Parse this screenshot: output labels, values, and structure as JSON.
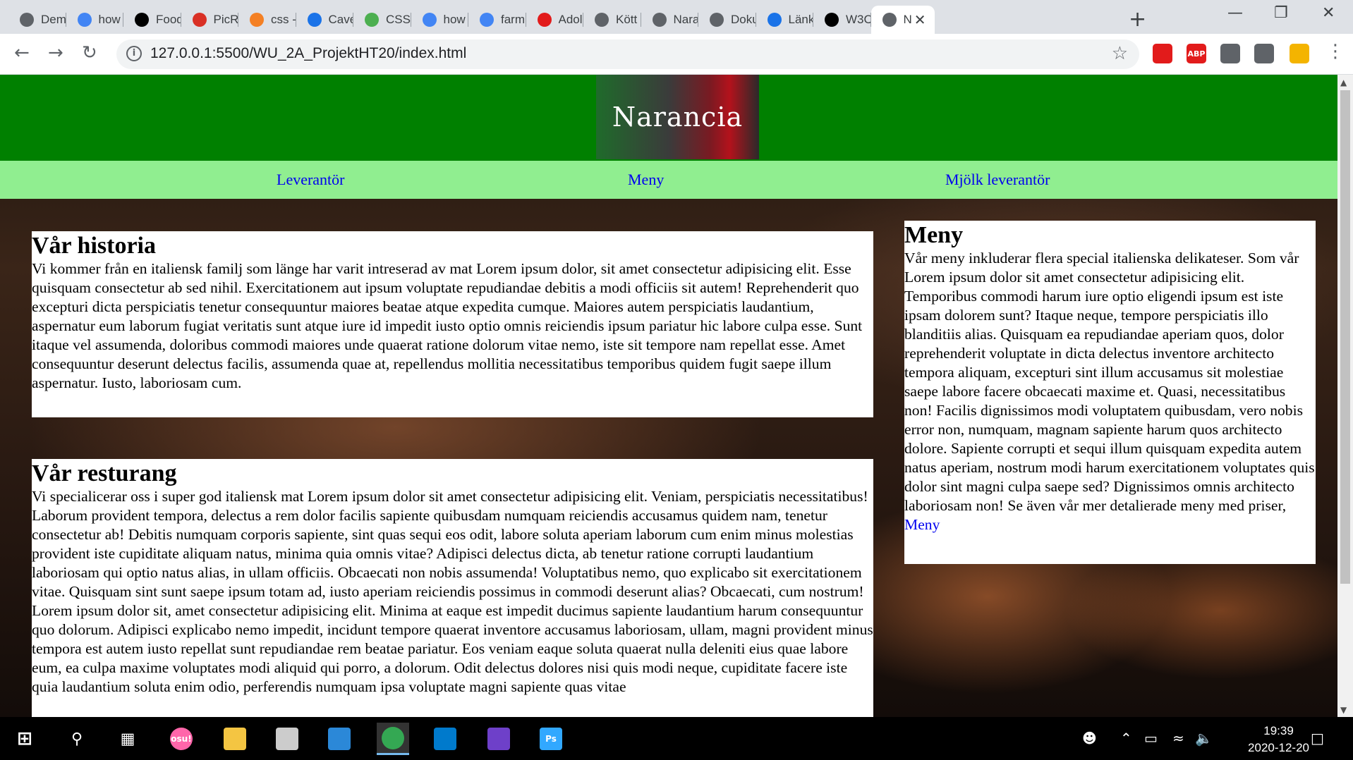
{
  "browser": {
    "tabs": [
      {
        "label": "Dem",
        "icon": "globe-icon",
        "color": "#5f6368"
      },
      {
        "label": "how",
        "icon": "google-icon",
        "color": "#4285f4"
      },
      {
        "label": "Food",
        "icon": "unsplash-icon",
        "color": "#000000"
      },
      {
        "label": "PicRe",
        "icon": "picresize-icon",
        "color": "#d93025"
      },
      {
        "label": "css -",
        "icon": "stackoverflow-icon",
        "color": "#f48024"
      },
      {
        "label": "Cave",
        "icon": "f-icon",
        "color": "#1a73e8"
      },
      {
        "label": "CSS",
        "icon": "w3schools-icon",
        "color": "#4caf50"
      },
      {
        "label": "how",
        "icon": "google-icon",
        "color": "#4285f4"
      },
      {
        "label": "farm",
        "icon": "google-icon",
        "color": "#4285f4"
      },
      {
        "label": "Adol",
        "icon": "adobe-icon",
        "color": "#e21b1b"
      },
      {
        "label": "Kött",
        "icon": "globe-icon",
        "color": "#5f6368"
      },
      {
        "label": "Nara",
        "icon": "globe-icon",
        "color": "#5f6368"
      },
      {
        "label": "Doku",
        "icon": "globe-icon",
        "color": "#5f6368"
      },
      {
        "label": "Länk",
        "icon": "contact-icon",
        "color": "#1a73e8"
      },
      {
        "label": "W3C",
        "icon": "w3c-icon",
        "color": "#000000"
      },
      {
        "label": "N",
        "icon": "globe-icon",
        "color": "#5f6368"
      }
    ],
    "url": "127.0.0.1:5500/WU_2A_ProjektHT20/index.html",
    "extensions": [
      {
        "name": "pdf-extension-icon",
        "label": "",
        "color": "#e21b1b"
      },
      {
        "name": "adblock-icon",
        "label": "ABP",
        "color": "#e21b1b"
      },
      {
        "name": "extension-icon",
        "label": "",
        "color": "#5f6368"
      },
      {
        "name": "puzzle-icon",
        "label": "",
        "color": "#5f6368"
      },
      {
        "name": "profile-icon",
        "label": "",
        "color": "#f4b400"
      }
    ]
  },
  "site": {
    "logo": "Narancia",
    "nav": [
      "Leverantör",
      "Meny",
      "Mjölk leverantör"
    ],
    "story": {
      "title": "Vår historia",
      "text": "Vi kommer från en italiensk familj som länge har varit intreserad av mat Lorem ipsum dolor, sit amet consectetur adipisicing elit. Esse quisquam consectetur ab sed nihil. Exercitationem aut ipsum voluptate repudiandae debitis a modi officiis sit autem! Reprehenderit quo excepturi dicta perspiciatis tenetur consequuntur maiores beatae atque expedita cumque. Maiores autem perspiciatis laudantium, aspernatur eum laborum fugiat veritatis sunt atque iure id impedit iusto optio omnis reiciendis ipsum pariatur hic labore culpa esse. Sunt itaque vel assumenda, doloribus commodi maiores unde quaerat ratione dolorum vitae nemo, iste sit tempore nam repellat esse. Amet consequuntur deserunt delectus facilis, assumenda quae at, repellendus mollitia necessitatibus temporibus quidem fugit saepe illum aspernatur. Iusto, laboriosam cum."
    },
    "restaurant": {
      "title": "Vår resturang",
      "text": "Vi specialicerar oss i super god italiensk mat Lorem ipsum dolor sit amet consectetur adipisicing elit. Veniam, perspiciatis necessitatibus! Laborum provident tempora, delectus a rem dolor facilis sapiente quibusdam numquam reiciendis accusamus quidem nam, tenetur consectetur ab! Debitis numquam corporis sapiente, sint quas sequi eos odit, labore soluta aperiam laborum cum enim minus molestias provident iste cupiditate aliquam natus, minima quia omnis vitae? Adipisci delectus dicta, ab tenetur ratione corrupti laudantium laboriosam qui optio natus alias, in ullam officiis. Obcaecati non nobis assumenda! Voluptatibus nemo, quo explicabo sit exercitationem vitae. Quisquam sint sunt saepe ipsum totam ad, iusto aperiam reiciendis possimus in commodi deserunt alias? Obcaecati, cum nostrum! Lorem ipsum dolor sit, amet consectetur adipisicing elit. Minima at eaque est impedit ducimus sapiente laudantium harum consequuntur quo dolorum. Adipisci explicabo nemo impedit, incidunt tempore quaerat inventore accusamus laboriosam, ullam, magni provident minus tempora est autem iusto repellat sunt repudiandae rem beatae pariatur. Eos veniam eaque soluta quaerat nulla deleniti eius quae labore eum, ea culpa maxime voluptates modi aliquid qui porro, a dolorum. Odit delectus dolores nisi quis modi neque, cupiditate facere iste quia laudantium soluta enim odio, perferendis numquam ipsa voluptate magni sapiente quas vitae"
    },
    "menu": {
      "title": "Meny",
      "text": "Vår meny inkluderar flera special italienska delikateser. Som vår Lorem ipsum dolor sit amet consectetur adipisicing elit. Temporibus commodi harum iure optio eligendi ipsum est iste ipsam dolorem sunt? Itaque neque, tempore perspiciatis illo blanditiis alias. Quisquam ea repudiandae aperiam quos, dolor reprehenderit voluptate in dicta delectus inventore architecto tempora aliquam, excepturi sint illum accusamus sit molestiae saepe labore facere obcaecati maxime et. Quasi, necessitatibus non! Facilis dignissimos modi voluptatem quibusdam, vero nobis error non, numquam, magnam sapiente harum quos architecto dolore. Sapiente corrupti et sequi illum quisquam expedita autem natus aperiam, nostrum modi harum exercitationem voluptates quis dolor sint magni culpa saepe sed? Dignissimos omnis architecto laboriosam non! Se även vår mer detalierade meny med priser, ",
      "link": "Meny"
    }
  },
  "taskbar": {
    "apps": [
      {
        "name": "osu-icon",
        "label": "osu!",
        "color": "#ff66aa"
      },
      {
        "name": "file-explorer-icon",
        "label": "",
        "color": "#f4c542"
      },
      {
        "name": "store-icon",
        "label": "",
        "color": "#cccccc"
      },
      {
        "name": "mail-icon",
        "label": "",
        "color": "#2b88d8"
      },
      {
        "name": "chrome-icon",
        "label": "",
        "color": "#34a853"
      },
      {
        "name": "vscode-icon",
        "label": "",
        "color": "#007acc"
      },
      {
        "name": "github-desktop-icon",
        "label": "",
        "color": "#6e40c9"
      },
      {
        "name": "photoshop-icon",
        "label": "Ps",
        "color": "#31a8ff"
      }
    ],
    "time": "19:39",
    "date": "2020-12-20"
  }
}
